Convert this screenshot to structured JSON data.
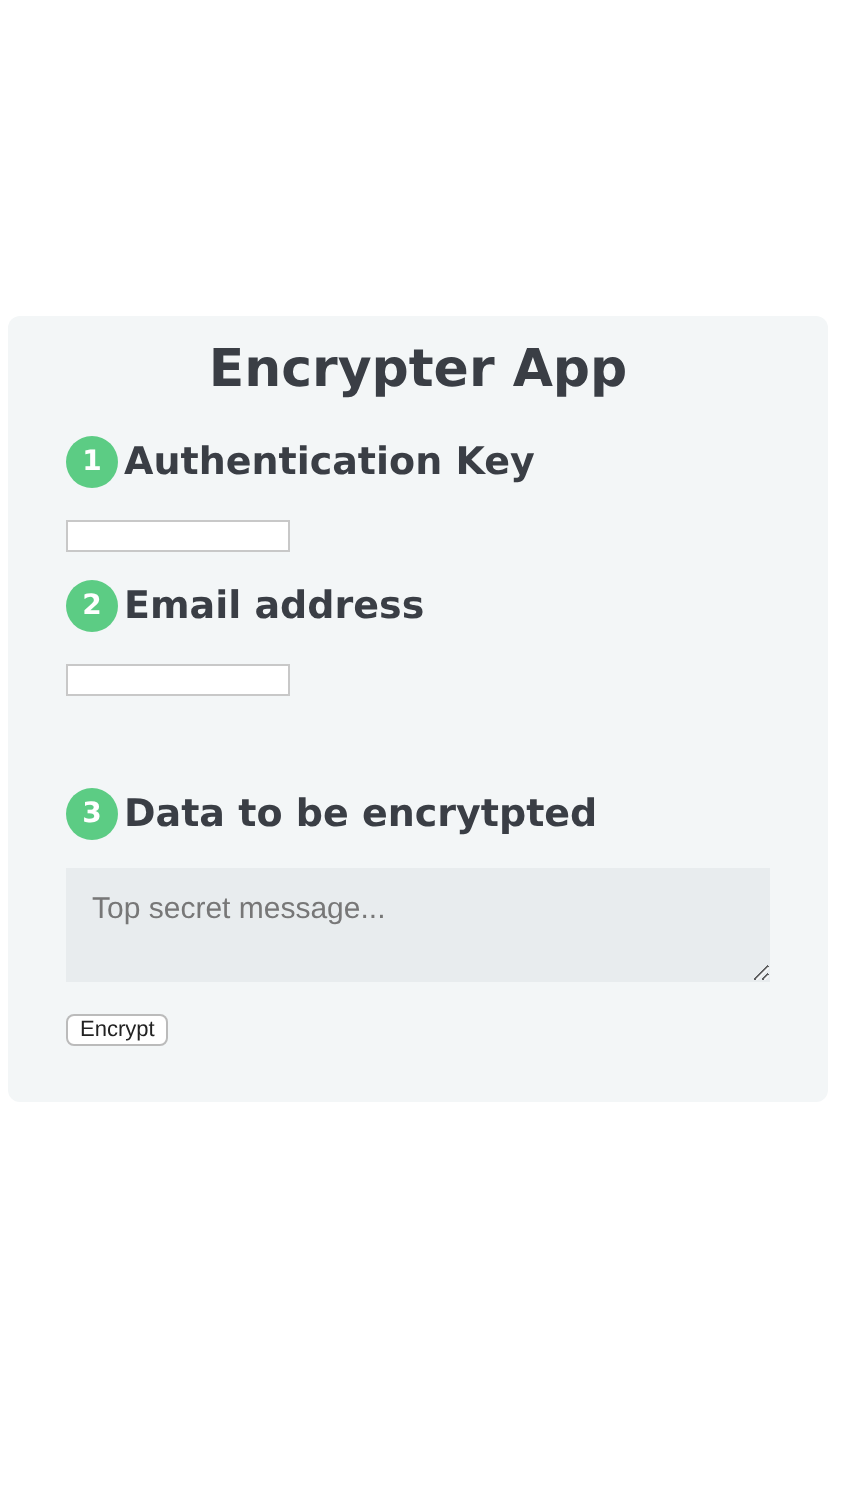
{
  "title": "Encrypter App",
  "steps": [
    {
      "number": "1",
      "label": "Authentication Key",
      "kind": "input"
    },
    {
      "number": "2",
      "label": "Email address",
      "kind": "input"
    },
    {
      "number": "3",
      "label": "Data to be encrytpted",
      "kind": "textarea",
      "placeholder": "Top secret message..."
    }
  ],
  "button": "Encrypt"
}
